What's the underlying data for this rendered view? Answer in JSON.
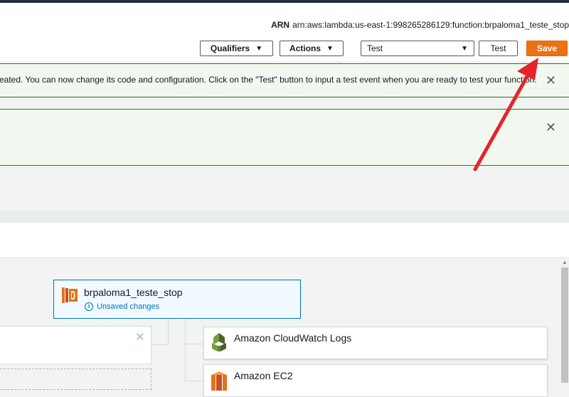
{
  "header": {
    "arn_label": "ARN",
    "arn_value": "arn:aws:lambda:us-east-1:998265286129:function:brpaloma1_teste_stop"
  },
  "toolbar": {
    "qualifiers_label": "Qualifiers",
    "actions_label": "Actions",
    "test_event_value": "Test",
    "test_label": "Test",
    "save_label": "Save"
  },
  "flash": {
    "message": "eated. You can now change its code and configuration. Click on the \"Test\" button to input a test event when you are ready to test your function."
  },
  "designer": {
    "function_name": "brpaloma1_teste_stop",
    "status": "Unsaved changes",
    "resources": [
      {
        "label": "Amazon CloudWatch Logs",
        "icon": "cloudwatch-logs-icon"
      },
      {
        "label": "Amazon EC2",
        "icon": "ec2-icon"
      }
    ]
  },
  "colors": {
    "accent": "#ec7211",
    "success_border": "#1d8102",
    "link": "#0073bb",
    "annotation_arrow": "#e8222a"
  }
}
